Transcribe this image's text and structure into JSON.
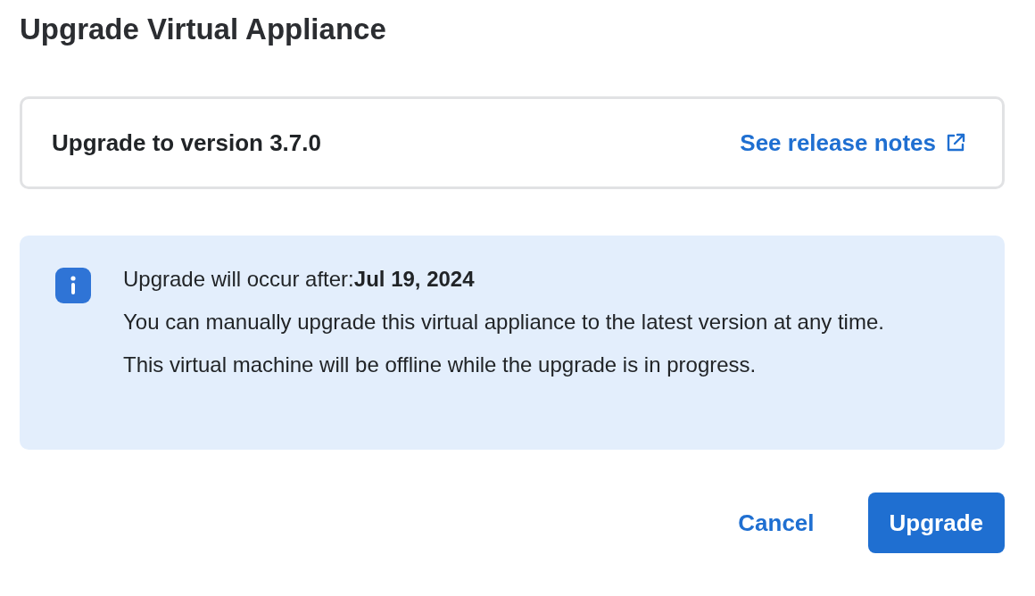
{
  "dialog": {
    "title": "Upgrade Virtual Appliance"
  },
  "version_card": {
    "label": "Upgrade to version 3.7.0",
    "link": "See release notes"
  },
  "info": {
    "heading": "Upgrade will occur after:**Jul 19, 2024**",
    "body": "You can manually upgrade this virtual appliance to the latest version at any time. This virtual machine will be offline while the upgrade is in progress."
  },
  "buttons": [
    {
      "label": "Cancel",
      "kind": "secondary"
    },
    {
      "label": "Upgrade",
      "kind": "primary"
    }
  ]
}
